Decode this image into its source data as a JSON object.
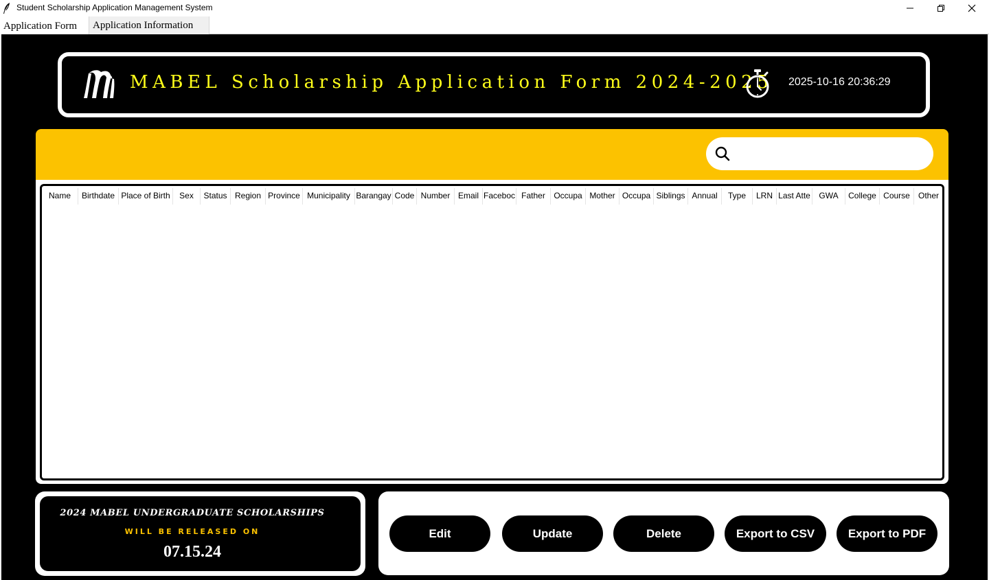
{
  "window": {
    "title": "Student Scholarship Application Management System"
  },
  "tabs": [
    {
      "label": "Application Form"
    },
    {
      "label": "Application Information"
    }
  ],
  "header": {
    "title": "MABEL Scholarship Application Form 2024-2025",
    "datetime": "2025-10-16 20:36:29",
    "title_color": "#ffff1a"
  },
  "search": {
    "placeholder": "",
    "value": ""
  },
  "table": {
    "columns": [
      "Name",
      "Birthdate",
      "Place of Birth",
      "Sex",
      "Status",
      "Region",
      "Province",
      "Municipality",
      "Barangay",
      "Code",
      "Number",
      "Email",
      "Faceboc",
      "Father",
      "Occupa",
      "Mother",
      "Occupa",
      "Siblings",
      "Annual",
      "Type",
      "LRN",
      "Last Atte",
      "GWA",
      "College",
      "Course",
      "Other"
    ],
    "rows": []
  },
  "announcement": {
    "title": "2024 MABEL UNDERGRADUATE SCHOLARSHIPS",
    "subtitle": "WILL BE RELEASED ON",
    "date": "07.15.24"
  },
  "actions": {
    "edit": "Edit",
    "update": "Update",
    "delete": "Delete",
    "export_csv": "Export to CSV",
    "export_pdf": "Export to PDF"
  },
  "colors": {
    "accent": "#fcc200",
    "background": "#000000"
  }
}
